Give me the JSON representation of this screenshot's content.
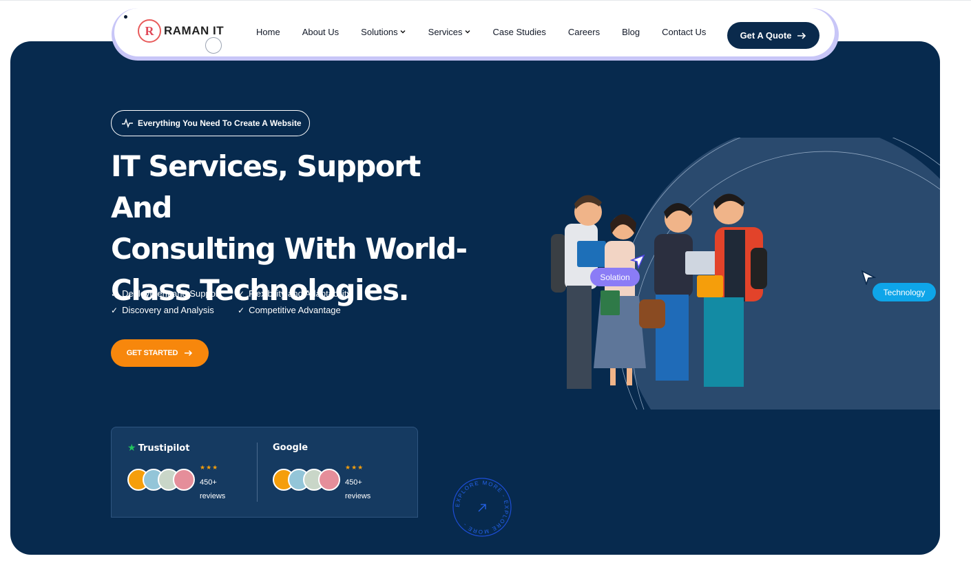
{
  "brand": {
    "logo_text": "RAMAN IT",
    "logo_mark": "R"
  },
  "nav": {
    "items": [
      {
        "label": "Home",
        "dropdown": false
      },
      {
        "label": "About Us",
        "dropdown": false
      },
      {
        "label": "Solutions",
        "dropdown": true
      },
      {
        "label": "Services",
        "dropdown": true
      },
      {
        "label": "Case Studies",
        "dropdown": false
      },
      {
        "label": "Careers",
        "dropdown": false
      },
      {
        "label": "Blog",
        "dropdown": false
      },
      {
        "label": "Contact Us",
        "dropdown": false
      }
    ],
    "quote_label": "Get A Quote",
    "chevron_icon": "chevron-down-icon"
  },
  "hero": {
    "badge": "Everything You Need To Create A Website",
    "headline_lines": [
      "IT Services, Support And",
      "Consulting With World-",
      "Class Technologies."
    ],
    "features": [
      "Deployment and Support",
      "Flexibility and Adaptability",
      "Discovery and Analysis",
      "Competitive Advantage"
    ],
    "cta": "GET STARTED"
  },
  "reviews": {
    "trustpilot": {
      "title": "Trustipilot",
      "count": "450+",
      "unit": "reviews",
      "stars": "★★★"
    },
    "google": {
      "title": "Google",
      "count": "450+",
      "unit": "reviews",
      "stars": "★★★"
    }
  },
  "explore": {
    "text": "EXPLORE MORE - EXPLORE MORE - "
  },
  "illustration": {
    "tag_left": "Solation",
    "tag_right": "Technology"
  },
  "colors": {
    "hero_bg": "#072a4e",
    "accent_orange": "#f7870c",
    "nav_shadow": "#c8c6f7",
    "purple_tag": "#8b7cf6",
    "blue_tag": "#0ea5e9"
  }
}
